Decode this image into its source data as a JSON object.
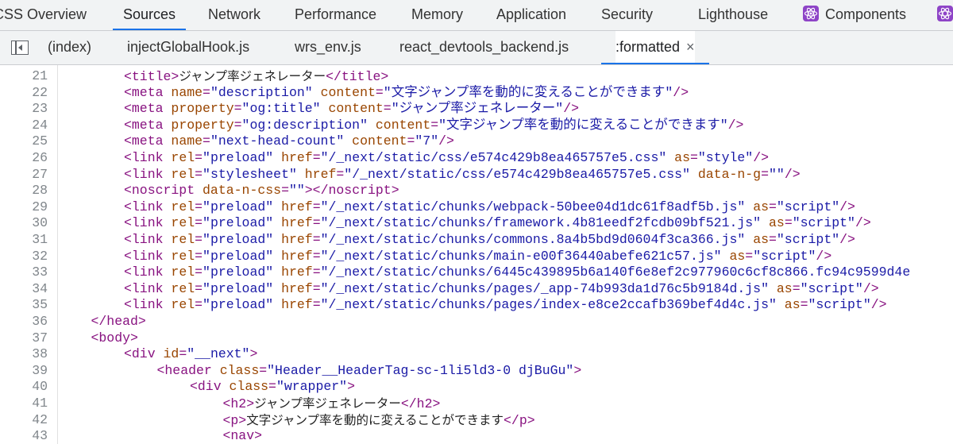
{
  "panel_tabs": [
    {
      "label": "CSS Overview",
      "active": false
    },
    {
      "label": "Sources",
      "active": true
    },
    {
      "label": "Network",
      "active": false
    },
    {
      "label": "Performance",
      "active": false
    },
    {
      "label": "Memory",
      "active": false
    },
    {
      "label": "Application",
      "active": false
    },
    {
      "label": "Security",
      "active": false
    },
    {
      "label": "Lighthouse",
      "active": false
    },
    {
      "label": "Components",
      "active": false,
      "icon": "react-icon"
    },
    {
      "label": "",
      "active": false,
      "icon": "react-icon"
    }
  ],
  "file_tabs": [
    {
      "label": "(index)",
      "active": false
    },
    {
      "label": "injectGlobalHook.js",
      "active": false
    },
    {
      "label": "wrs_env.js",
      "active": false
    },
    {
      "label": "react_devtools_backend.js",
      "active": false
    },
    {
      "label": ":formatted",
      "active": true,
      "closable": true
    }
  ],
  "icons": {
    "navigator_toggle": "sidebar-toggle-icon",
    "close": "close-icon",
    "close_glyph": "×",
    "components_tab": "react-icon"
  },
  "colors": {
    "tag": "#881280",
    "attribute": "#994500",
    "value": "#1a1aa6",
    "accent": "#1a73e8"
  },
  "code_lines": [
    {
      "num": "21",
      "indent": 2,
      "tokens": [
        [
          "t",
          "<title>"
        ],
        [
          "x",
          "ジャンプ率ジェネレーター"
        ],
        [
          "t",
          "</title>"
        ]
      ]
    },
    {
      "num": "22",
      "indent": 2,
      "tokens": [
        [
          "t",
          "<meta "
        ],
        [
          "a",
          "name"
        ],
        [
          "t",
          "="
        ],
        [
          "v",
          "\"description\""
        ],
        [
          "t",
          " "
        ],
        [
          "a",
          "content"
        ],
        [
          "t",
          "="
        ],
        [
          "v",
          "\"文字ジャンプ率を動的に変えることができます\""
        ],
        [
          "t",
          "/>"
        ]
      ]
    },
    {
      "num": "23",
      "indent": 2,
      "tokens": [
        [
          "t",
          "<meta "
        ],
        [
          "a",
          "property"
        ],
        [
          "t",
          "="
        ],
        [
          "v",
          "\"og:title\""
        ],
        [
          "t",
          " "
        ],
        [
          "a",
          "content"
        ],
        [
          "t",
          "="
        ],
        [
          "v",
          "\"ジャンプ率ジェネレーター\""
        ],
        [
          "t",
          "/>"
        ]
      ]
    },
    {
      "num": "24",
      "indent": 2,
      "tokens": [
        [
          "t",
          "<meta "
        ],
        [
          "a",
          "property"
        ],
        [
          "t",
          "="
        ],
        [
          "v",
          "\"og:description\""
        ],
        [
          "t",
          " "
        ],
        [
          "a",
          "content"
        ],
        [
          "t",
          "="
        ],
        [
          "v",
          "\"文字ジャンプ率を動的に変えることができます\""
        ],
        [
          "t",
          "/>"
        ]
      ]
    },
    {
      "num": "25",
      "indent": 2,
      "tokens": [
        [
          "t",
          "<meta "
        ],
        [
          "a",
          "name"
        ],
        [
          "t",
          "="
        ],
        [
          "v",
          "\"next-head-count\""
        ],
        [
          "t",
          " "
        ],
        [
          "a",
          "content"
        ],
        [
          "t",
          "="
        ],
        [
          "v",
          "\"7\""
        ],
        [
          "t",
          "/>"
        ]
      ]
    },
    {
      "num": "26",
      "indent": 2,
      "tokens": [
        [
          "t",
          "<link "
        ],
        [
          "a",
          "rel"
        ],
        [
          "t",
          "="
        ],
        [
          "v",
          "\"preload\""
        ],
        [
          "t",
          " "
        ],
        [
          "a",
          "href"
        ],
        [
          "t",
          "="
        ],
        [
          "v",
          "\"/_next/static/css/e574c429b8ea465757e5.css\""
        ],
        [
          "t",
          " "
        ],
        [
          "a",
          "as"
        ],
        [
          "t",
          "="
        ],
        [
          "v",
          "\"style\""
        ],
        [
          "t",
          "/>"
        ]
      ]
    },
    {
      "num": "27",
      "indent": 2,
      "tokens": [
        [
          "t",
          "<link "
        ],
        [
          "a",
          "rel"
        ],
        [
          "t",
          "="
        ],
        [
          "v",
          "\"stylesheet\""
        ],
        [
          "t",
          " "
        ],
        [
          "a",
          "href"
        ],
        [
          "t",
          "="
        ],
        [
          "v",
          "\"/_next/static/css/e574c429b8ea465757e5.css\""
        ],
        [
          "t",
          " "
        ],
        [
          "a",
          "data-n-g"
        ],
        [
          "t",
          "="
        ],
        [
          "v",
          "\"\""
        ],
        [
          "t",
          "/>"
        ]
      ]
    },
    {
      "num": "28",
      "indent": 2,
      "tokens": [
        [
          "t",
          "<noscript "
        ],
        [
          "a",
          "data-n-css"
        ],
        [
          "t",
          "="
        ],
        [
          "v",
          "\"\""
        ],
        [
          "t",
          "></noscript>"
        ]
      ]
    },
    {
      "num": "29",
      "indent": 2,
      "tokens": [
        [
          "t",
          "<link "
        ],
        [
          "a",
          "rel"
        ],
        [
          "t",
          "="
        ],
        [
          "v",
          "\"preload\""
        ],
        [
          "t",
          " "
        ],
        [
          "a",
          "href"
        ],
        [
          "t",
          "="
        ],
        [
          "v",
          "\"/_next/static/chunks/webpack-50bee04d1dc61f8adf5b.js\""
        ],
        [
          "t",
          " "
        ],
        [
          "a",
          "as"
        ],
        [
          "t",
          "="
        ],
        [
          "v",
          "\"script\""
        ],
        [
          "t",
          "/>"
        ]
      ]
    },
    {
      "num": "30",
      "indent": 2,
      "tokens": [
        [
          "t",
          "<link "
        ],
        [
          "a",
          "rel"
        ],
        [
          "t",
          "="
        ],
        [
          "v",
          "\"preload\""
        ],
        [
          "t",
          " "
        ],
        [
          "a",
          "href"
        ],
        [
          "t",
          "="
        ],
        [
          "v",
          "\"/_next/static/chunks/framework.4b81eedf2fcdb09bf521.js\""
        ],
        [
          "t",
          " "
        ],
        [
          "a",
          "as"
        ],
        [
          "t",
          "="
        ],
        [
          "v",
          "\"script\""
        ],
        [
          "t",
          "/>"
        ]
      ]
    },
    {
      "num": "31",
      "indent": 2,
      "tokens": [
        [
          "t",
          "<link "
        ],
        [
          "a",
          "rel"
        ],
        [
          "t",
          "="
        ],
        [
          "v",
          "\"preload\""
        ],
        [
          "t",
          " "
        ],
        [
          "a",
          "href"
        ],
        [
          "t",
          "="
        ],
        [
          "v",
          "\"/_next/static/chunks/commons.8a4b5bd9d0604f3ca366.js\""
        ],
        [
          "t",
          " "
        ],
        [
          "a",
          "as"
        ],
        [
          "t",
          "="
        ],
        [
          "v",
          "\"script\""
        ],
        [
          "t",
          "/>"
        ]
      ]
    },
    {
      "num": "32",
      "indent": 2,
      "tokens": [
        [
          "t",
          "<link "
        ],
        [
          "a",
          "rel"
        ],
        [
          "t",
          "="
        ],
        [
          "v",
          "\"preload\""
        ],
        [
          "t",
          " "
        ],
        [
          "a",
          "href"
        ],
        [
          "t",
          "="
        ],
        [
          "v",
          "\"/_next/static/chunks/main-e00f36440abefe621c57.js\""
        ],
        [
          "t",
          " "
        ],
        [
          "a",
          "as"
        ],
        [
          "t",
          "="
        ],
        [
          "v",
          "\"script\""
        ],
        [
          "t",
          "/>"
        ]
      ]
    },
    {
      "num": "33",
      "indent": 2,
      "tokens": [
        [
          "t",
          "<link "
        ],
        [
          "a",
          "rel"
        ],
        [
          "t",
          "="
        ],
        [
          "v",
          "\"preload\""
        ],
        [
          "t",
          " "
        ],
        [
          "a",
          "href"
        ],
        [
          "t",
          "="
        ],
        [
          "v",
          "\"/_next/static/chunks/6445c439895b6a140f6e8ef2c977960c6cf8c866.fc94c9599d4e"
        ]
      ]
    },
    {
      "num": "34",
      "indent": 2,
      "tokens": [
        [
          "t",
          "<link "
        ],
        [
          "a",
          "rel"
        ],
        [
          "t",
          "="
        ],
        [
          "v",
          "\"preload\""
        ],
        [
          "t",
          " "
        ],
        [
          "a",
          "href"
        ],
        [
          "t",
          "="
        ],
        [
          "v",
          "\"/_next/static/chunks/pages/_app-74b993da1d76c5b9184d.js\""
        ],
        [
          "t",
          " "
        ],
        [
          "a",
          "as"
        ],
        [
          "t",
          "="
        ],
        [
          "v",
          "\"script\""
        ],
        [
          "t",
          "/>"
        ]
      ]
    },
    {
      "num": "35",
      "indent": 2,
      "tokens": [
        [
          "t",
          "<link "
        ],
        [
          "a",
          "rel"
        ],
        [
          "t",
          "="
        ],
        [
          "v",
          "\"preload\""
        ],
        [
          "t",
          " "
        ],
        [
          "a",
          "href"
        ],
        [
          "t",
          "="
        ],
        [
          "v",
          "\"/_next/static/chunks/pages/index-e8ce2ccafb369bef4d4c.js\""
        ],
        [
          "t",
          " "
        ],
        [
          "a",
          "as"
        ],
        [
          "t",
          "="
        ],
        [
          "v",
          "\"script\""
        ],
        [
          "t",
          "/>"
        ]
      ]
    },
    {
      "num": "36",
      "indent": 1,
      "tokens": [
        [
          "t",
          "</head>"
        ]
      ]
    },
    {
      "num": "37",
      "indent": 1,
      "tokens": [
        [
          "t",
          "<body>"
        ]
      ]
    },
    {
      "num": "38",
      "indent": 2,
      "tokens": [
        [
          "t",
          "<div "
        ],
        [
          "a",
          "id"
        ],
        [
          "t",
          "="
        ],
        [
          "v",
          "\"__next\""
        ],
        [
          "t",
          ">"
        ]
      ]
    },
    {
      "num": "39",
      "indent": 3,
      "tokens": [
        [
          "t",
          "<header "
        ],
        [
          "a",
          "class"
        ],
        [
          "t",
          "="
        ],
        [
          "v",
          "\"Header__HeaderTag-sc-1li5ld3-0 djBuGu\""
        ],
        [
          "t",
          ">"
        ]
      ]
    },
    {
      "num": "40",
      "indent": 4,
      "tokens": [
        [
          "t",
          "<div "
        ],
        [
          "a",
          "class"
        ],
        [
          "t",
          "="
        ],
        [
          "v",
          "\"wrapper\""
        ],
        [
          "t",
          ">"
        ]
      ]
    },
    {
      "num": "41",
      "indent": 5,
      "tokens": [
        [
          "t",
          "<h2>"
        ],
        [
          "x",
          "ジャンプ率ジェネレーター"
        ],
        [
          "t",
          "</h2>"
        ]
      ]
    },
    {
      "num": "42",
      "indent": 5,
      "tokens": [
        [
          "t",
          "<p>"
        ],
        [
          "x",
          "文字ジャンプ率を動的に変えることができます"
        ],
        [
          "t",
          "</p>"
        ]
      ]
    },
    {
      "num": "43",
      "indent": 5,
      "tokens": [
        [
          "t",
          "<nav>"
        ]
      ]
    }
  ]
}
